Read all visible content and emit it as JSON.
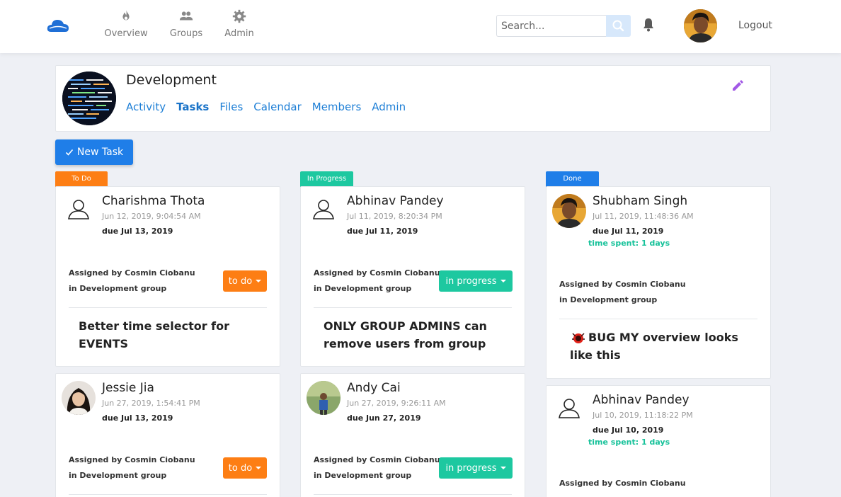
{
  "nav": {
    "items": [
      {
        "label": "Overview",
        "icon": "fire-icon"
      },
      {
        "label": "Groups",
        "icon": "people-icon"
      },
      {
        "label": "Admin",
        "icon": "gear-icon"
      }
    ],
    "search_placeholder": "Search...",
    "logout_label": "Logout"
  },
  "group": {
    "title": "Development",
    "tabs": [
      "Activity",
      "Tasks",
      "Files",
      "Calendar",
      "Members",
      "Admin"
    ],
    "active_tab": "Tasks"
  },
  "new_task_label": "New Task",
  "columns": [
    {
      "tag": "To Do",
      "color": "#fd7e14"
    },
    {
      "tag": "In Progress",
      "color": "#1dc8a0"
    },
    {
      "tag": "Done",
      "color": "#1f7ee8"
    }
  ],
  "cards": {
    "todo1": {
      "name": "Charishma Thota",
      "date": "Jun 12, 2019, 9:04:54 AM",
      "due": "due Jul 13, 2019",
      "assigned": "Assigned by Cosmin Ciobanu",
      "group": "in Development group",
      "status": "to do",
      "desc": "Better time selector for EVENTS"
    },
    "todo2": {
      "name": "Jessie Jia",
      "date": "Jun 27, 2019, 1:54:41 PM",
      "due": "due Jul 13, 2019",
      "assigned": "Assigned by Cosmin Ciobanu",
      "group": "in Development group",
      "status": "to do"
    },
    "prog1": {
      "name": "Abhinav Pandey",
      "date": "Jul 11, 2019, 8:20:34 PM",
      "due": "due Jul 11, 2019",
      "assigned": "Assigned by Cosmin Ciobanu",
      "group": "in Development group",
      "status": "in progress",
      "desc": "ONLY GROUP ADMINS can remove users from group"
    },
    "prog2": {
      "name": "Andy Cai",
      "date": "Jun 27, 2019, 9:26:11 AM",
      "due": "due Jun 27, 2019",
      "assigned": "Assigned by Cosmin Ciobanu",
      "group": "in Development group",
      "status": "in progress"
    },
    "done1": {
      "name": "Shubham Singh",
      "date": "Jul 11, 2019, 11:48:36 AM",
      "due": "due Jul 11, 2019",
      "spent": "time spent: 1 days",
      "assigned": "Assigned by Cosmin Ciobanu",
      "group": "in Development group",
      "desc": "BUG MY overview looks like this"
    },
    "done2": {
      "name": "Abhinav Pandey",
      "date": "Jul 10, 2019, 11:18:22 PM",
      "due": "due Jul 10, 2019",
      "spent": "time spent: 1 days",
      "assigned": "Assigned by Cosmin Ciobanu"
    }
  }
}
